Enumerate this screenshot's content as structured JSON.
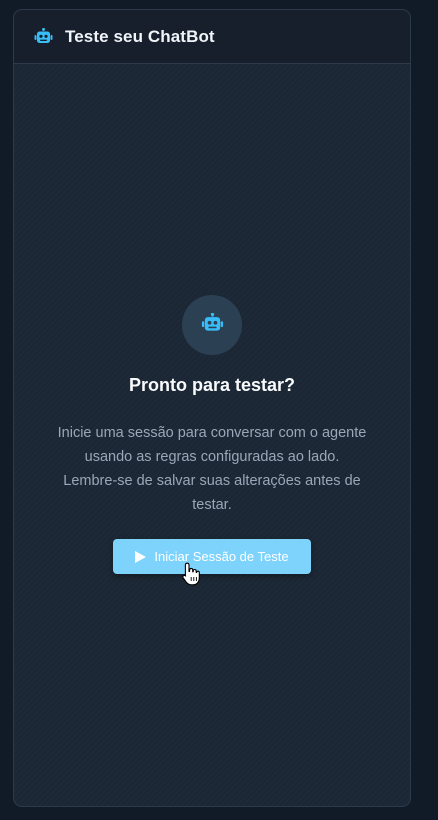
{
  "header": {
    "icon": "robot-icon",
    "title": "Teste seu ChatBot"
  },
  "empty_state": {
    "icon": "robot-icon",
    "title": "Pronto para testar?",
    "description": "Inicie uma sessão para conversar com o agente usando as regras configuradas ao lado. Lembre-se de salvar suas alterações antes de testar."
  },
  "start_button": {
    "icon": "play-icon",
    "label": "Iniciar Sessão de Teste"
  },
  "colors": {
    "accent": "#7dd3fc",
    "icon": "#38bdf8",
    "panel_bg": "#1c2735",
    "page_bg": "#111b27"
  }
}
